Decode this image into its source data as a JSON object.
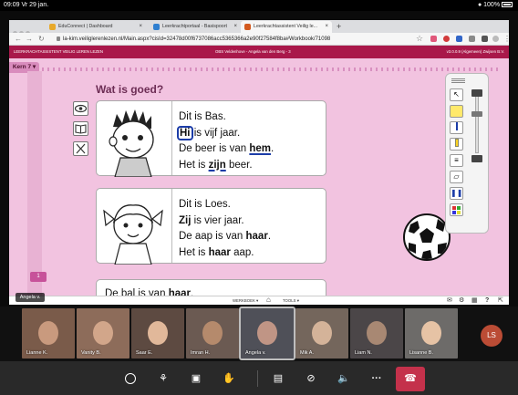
{
  "status": {
    "time_date": "09:09  Vr 29 jan.",
    "battery": "100%"
  },
  "browser": {
    "tabs": [
      {
        "label": "EduConnect | Dashboard",
        "color": "#e8a92a"
      },
      {
        "label": "Leerkrachtportaal - Basispoort",
        "color": "#2f7fd0"
      },
      {
        "label": "Leerkrachtassistent Veilig le...",
        "color": "#d35a1f"
      }
    ],
    "url": "la-kim.veiliglerenlezen.nl/Main.aspx?cisId=32478d00f6737086acc5365366a2e90f27584f8ba#Workbook/71098"
  },
  "appbar": {
    "left": "LEERKRACHTASSISTENT VEILIG LEREN LEZEN",
    "center": "OBS Veldenhove - Angela van den Berg - 3",
    "right": "v3.0.0.9 (Algemeen) Zwijsen B.V."
  },
  "lesson": {
    "kern": "Kern 7",
    "question_title": "Wat is goed?",
    "page_number": "1",
    "card1": {
      "line1": "Dit is Bas.",
      "line2_bold": "Hi",
      "line2_rest": " is vijf jaar.",
      "line3_pre": "De beer is van ",
      "line3_bold": "hem",
      "line3_post": ".",
      "line4_pre": "Het is ",
      "line4_bold": "zijn",
      "line4_post": " beer."
    },
    "card2": {
      "line1": "Dit is Loes.",
      "line2_bold": "Zij",
      "line2_rest": " is vier jaar.",
      "line3_pre": "De aap is van ",
      "line3_bold": "haar",
      "line3_post": ".",
      "line4_pre": "Het is ",
      "line4_bold": "haar",
      "line4_post": " aap."
    },
    "card3": {
      "pre": "De bal is van ",
      "bold": "haar",
      "post": "."
    },
    "bottom_left": "WERKBOEK",
    "bottom_right": "TOOLS"
  },
  "speaker_label": "Angela v.",
  "participants": [
    {
      "name": "Lianne K.",
      "bg": "#7a5b4a",
      "face": "#c99a7e"
    },
    {
      "name": "Vanity B.",
      "bg": "#8d6c5a",
      "face": "#d2a68a"
    },
    {
      "name": "Saar E.",
      "bg": "#5d4a41",
      "face": "#e1b89a"
    },
    {
      "name": "Imran H.",
      "bg": "#6b5a52",
      "face": "#b58a6c"
    },
    {
      "name": "Angela v.",
      "bg": "#4f5058",
      "face": "#c09585"
    },
    {
      "name": "Mik A.",
      "bg": "#74665c",
      "face": "#d4b399"
    },
    {
      "name": "Liam N.",
      "bg": "#4b4648",
      "face": "#a88873"
    },
    {
      "name": "Lisanne B.",
      "bg": "#6d6b69",
      "face": "#e6c3a5"
    }
  ],
  "me_initials": "LS",
  "colors": {
    "accent": "#a9184a",
    "lesson_bg": "#f2c3e0",
    "underline_blue": "#1c3da8",
    "hangup": "#c4314b"
  }
}
